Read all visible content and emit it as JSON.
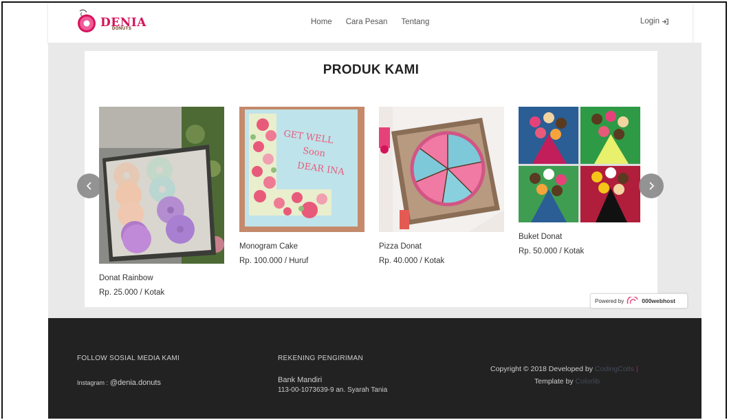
{
  "header": {
    "logo_text": "DENIA",
    "logo_sub": "DONUTS",
    "nav": [
      "Home",
      "Cara Pesan",
      "Tentang"
    ],
    "login_label": "Login"
  },
  "products_section": {
    "title": "PRODUK KAMI",
    "items": [
      {
        "name": "Donat Rainbow",
        "price": "Rp. 25.000 / Kotak"
      },
      {
        "name": "Monogram Cake",
        "price": "Rp. 100.000 / Huruf"
      },
      {
        "name": "Pizza Donat",
        "price": "Rp. 40.000 / Kotak"
      },
      {
        "name": "Buket Donat",
        "price": "Rp. 50.000 / Kotak"
      }
    ],
    "cake_text": [
      "GET WELL",
      "Soon",
      "DEAR INA"
    ]
  },
  "powered": {
    "prefix": "Powered by",
    "brand": "000webhost"
  },
  "footer": {
    "social_title": "FOLLOW SOSIAL MEDIA KAMI",
    "instagram_label": "Instagram :",
    "instagram_handle": "@denia.donuts",
    "bank_title": "REKENING PENGIRIMAN",
    "bank_name": "Bank Mandiri",
    "bank_account": "113-00-1073639-9 an. Syarah Tania",
    "copyright_prefix": "Copyright © 2018 Developed by",
    "developer": "CodingColts",
    "separator": "|",
    "template_prefix": "Template by",
    "template_author": "Colorlib"
  },
  "colors": {
    "brand": "#d4145a",
    "footer_bg": "#222222",
    "gray_band": "#e9e9e9"
  }
}
